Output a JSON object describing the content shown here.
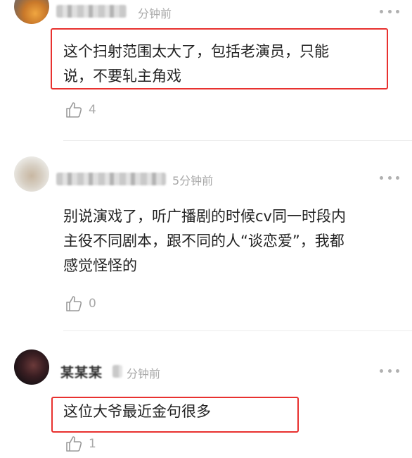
{
  "comments": [
    {
      "time": "分钟前",
      "lines": [
        "这个扫射范围太大了，包括老演员，只能",
        "说，不要轧主角戏"
      ],
      "likes": "4"
    },
    {
      "time": "5分钟前",
      "lines": [
        "别说演戏了，听广播剧的时候cv同一时段内",
        "主役不同剧本，跟不同的人“谈恋爱”，我都",
        "感觉怪怪的"
      ],
      "likes": "0"
    },
    {
      "name": "某某某",
      "time": "分钟前",
      "lines": [
        "这位大爷最近金句很多"
      ],
      "likes": "1"
    }
  ],
  "icons": {
    "like": "thumbs-up-icon",
    "more": "more-dots-icon"
  },
  "colors": {
    "highlight": "#e8312f",
    "secondary_text": "#a8a8a8"
  }
}
